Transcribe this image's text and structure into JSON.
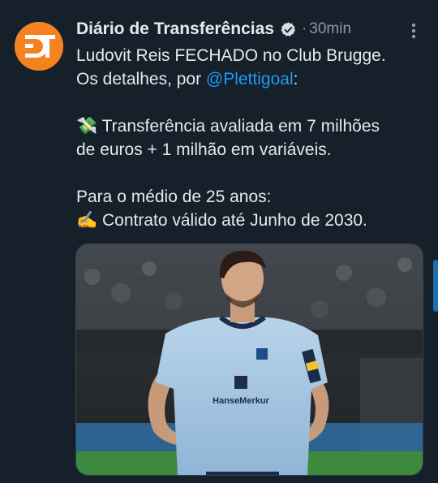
{
  "tweet": {
    "author_name": "Diário de Transferências",
    "time": "30min",
    "separator": "·",
    "lines": {
      "l1": "Ludovit Reis FECHADO no Club Brugge.",
      "l2_prefix": "Os detalhes, por ",
      "mention": "@Plettigoal",
      "l2_suffix": ":",
      "l3_emoji": "💸",
      "l3_text": " Transferência avaliada em 7 milhões",
      "l4": "de euros + 1 milhão em variáveis.",
      "l5": "Para o médio de 25 anos:",
      "l6_emoji": "✍️",
      "l6_text": " Contrato válido até Junho de 2030."
    },
    "avatar_initials": "DT",
    "media": {
      "jersey_sponsor": "HanseMerkur"
    }
  },
  "colors": {
    "background": "#15202b",
    "text": "#e7e9ea",
    "muted": "#8b98a5",
    "accent": "#1d9bf0",
    "avatar": "#f58220"
  },
  "icons": {
    "verified": "verified-badge-icon",
    "more": "more-options-icon"
  }
}
